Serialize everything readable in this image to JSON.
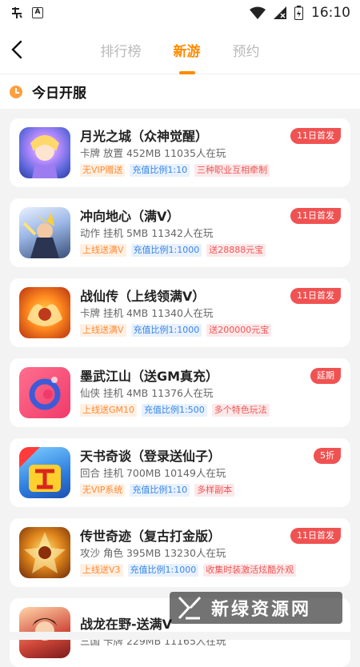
{
  "status_bar": {
    "time": "16:10",
    "left_icons": [
      "notification-app-icon",
      "text-a-icon"
    ],
    "right_icons": [
      "wifi-icon",
      "signal-icon",
      "battery-icon"
    ]
  },
  "header": {
    "tabs": [
      {
        "label": "排行榜",
        "active": false
      },
      {
        "label": "新游",
        "active": true
      },
      {
        "label": "预约",
        "active": false
      }
    ]
  },
  "section": {
    "title": "今日开服"
  },
  "games": [
    {
      "name": "月光之城（众神觉醒）",
      "meta": "卡牌 放置 452MB 11035人在玩",
      "badge": "11日首发",
      "tags": [
        {
          "text": "无VIP赠送",
          "color": "orange"
        },
        {
          "text": "充值比例1:10",
          "color": "blue"
        },
        {
          "text": "三种职业互相牵制",
          "color": "red"
        }
      ]
    },
    {
      "name": "冲向地心（满V）",
      "meta": "动作 挂机 5MB 11342人在玩",
      "badge": "11日首发",
      "tags": [
        {
          "text": "上线送满V",
          "color": "orange"
        },
        {
          "text": "充值比例1:1000",
          "color": "blue"
        },
        {
          "text": "送28888元宝",
          "color": "red"
        }
      ]
    },
    {
      "name": "战仙传（上线领满V）",
      "meta": "卡牌 挂机 4MB 11340人在玩",
      "badge": "11日首发",
      "tags": [
        {
          "text": "上线送满V",
          "color": "orange"
        },
        {
          "text": "充值比例1:1000",
          "color": "blue"
        },
        {
          "text": "送200000元宝",
          "color": "red"
        }
      ]
    },
    {
      "name": "墨武江山（送GM真充）",
      "meta": "仙侠 挂机 4MB 11376人在玩",
      "badge": "延期",
      "tags": [
        {
          "text": "上线送GM10",
          "color": "orange"
        },
        {
          "text": "充值比例1:500",
          "color": "blue"
        },
        {
          "text": "多个特色玩法",
          "color": "red"
        }
      ]
    },
    {
      "name": "天书奇谈（登录送仙子）",
      "meta": "回合 挂机 700MB 10149人在玩",
      "badge": "5折",
      "tags": [
        {
          "text": "无VIP系统",
          "color": "orange"
        },
        {
          "text": "充值比例1:10",
          "color": "blue"
        },
        {
          "text": "多样副本",
          "color": "red"
        }
      ]
    },
    {
      "name": "传世奇迹（复古打金版）",
      "meta": "攻沙 角色 395MB 13230人在玩",
      "badge": "11日首发",
      "tags": [
        {
          "text": "上线送V3",
          "color": "orange"
        },
        {
          "text": "充值比例1:1000",
          "color": "blue"
        },
        {
          "text": "收集时装激活炫酷外观",
          "color": "red"
        }
      ]
    },
    {
      "name": "战龙在野-送满V",
      "meta": "三国 卡牌 229MB 11165人在玩",
      "badge": "",
      "tags": []
    }
  ],
  "watermark": {
    "text": "新绿资源网"
  },
  "colors": {
    "accent": "#ff8a00",
    "badge": "#f05252"
  }
}
